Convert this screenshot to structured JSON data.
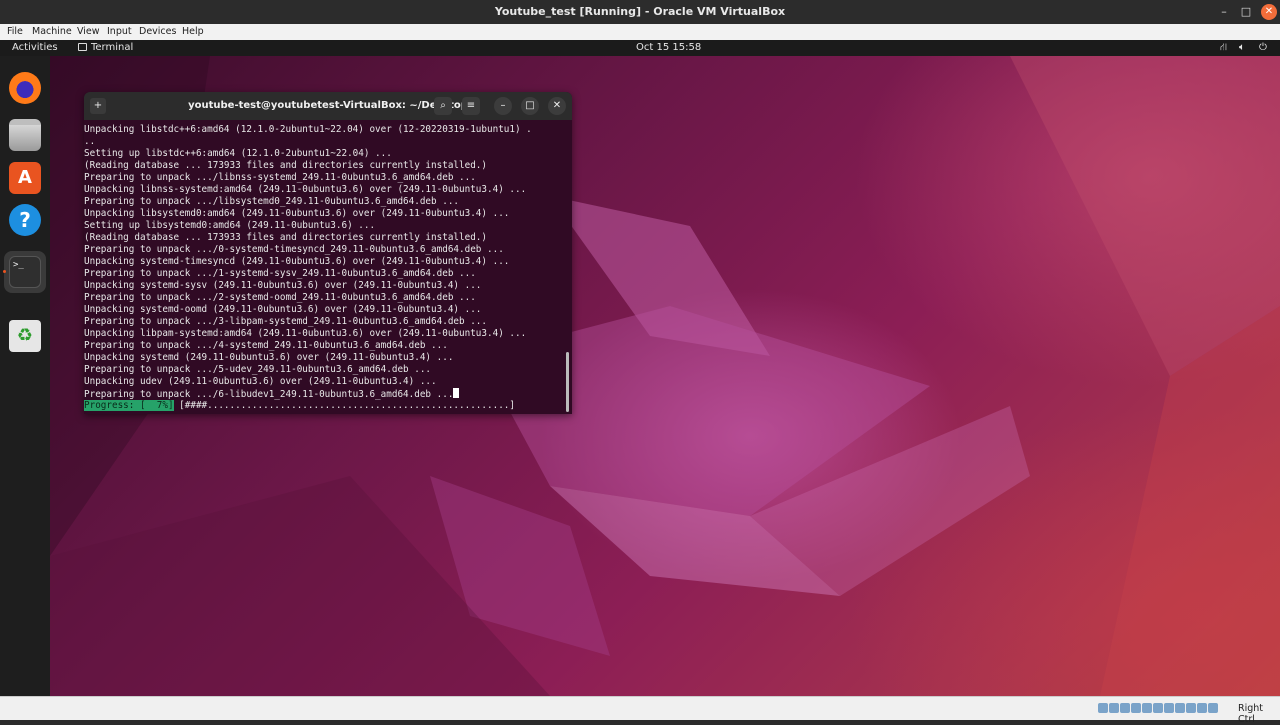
{
  "vbox": {
    "title": "Youtube_test [Running] - Oracle VM VirtualBox",
    "menu": [
      "File",
      "Machine",
      "View",
      "Input",
      "Devices",
      "Help"
    ],
    "host_key": "Right Ctrl"
  },
  "topbar": {
    "activities": "Activities",
    "app": "Terminal",
    "clock": "Oct 15  15:58"
  },
  "terminal": {
    "title": "youtube-test@youtubetest-VirtualBox: ~/Desktop",
    "lines": [
      "Unpacking libstdc++6:amd64 (12.1.0-2ubuntu1~22.04) over (12-20220319-1ubuntu1) .",
      "..",
      "Setting up libstdc++6:amd64 (12.1.0-2ubuntu1~22.04) ...",
      "(Reading database ... 173933 files and directories currently installed.)",
      "Preparing to unpack .../libnss-systemd_249.11-0ubuntu3.6_amd64.deb ...",
      "Unpacking libnss-systemd:amd64 (249.11-0ubuntu3.6) over (249.11-0ubuntu3.4) ...",
      "Preparing to unpack .../libsystemd0_249.11-0ubuntu3.6_amd64.deb ...",
      "Unpacking libsystemd0:amd64 (249.11-0ubuntu3.6) over (249.11-0ubuntu3.4) ...",
      "Setting up libsystemd0:amd64 (249.11-0ubuntu3.6) ...",
      "(Reading database ... 173933 files and directories currently installed.)",
      "Preparing to unpack .../0-systemd-timesyncd_249.11-0ubuntu3.6_amd64.deb ...",
      "Unpacking systemd-timesyncd (249.11-0ubuntu3.6) over (249.11-0ubuntu3.4) ...",
      "Preparing to unpack .../1-systemd-sysv_249.11-0ubuntu3.6_amd64.deb ...",
      "Unpacking systemd-sysv (249.11-0ubuntu3.6) over (249.11-0ubuntu3.4) ...",
      "Preparing to unpack .../2-systemd-oomd_249.11-0ubuntu3.6_amd64.deb ...",
      "Unpacking systemd-oomd (249.11-0ubuntu3.6) over (249.11-0ubuntu3.4) ...",
      "Preparing to unpack .../3-libpam-systemd_249.11-0ubuntu3.6_amd64.deb ...",
      "Unpacking libpam-systemd:amd64 (249.11-0ubuntu3.6) over (249.11-0ubuntu3.4) ...",
      "Preparing to unpack .../4-systemd_249.11-0ubuntu3.6_amd64.deb ...",
      "Unpacking systemd (249.11-0ubuntu3.6) over (249.11-0ubuntu3.4) ...",
      "Preparing to unpack .../5-udev_249.11-0ubuntu3.6_amd64.deb ...",
      "Unpacking udev (249.11-0ubuntu3.6) over (249.11-0ubuntu3.4) ...",
      "Preparing to unpack .../6-libudev1_249.11-0ubuntu3.6_amd64.deb ..."
    ],
    "progress_label": "Progress: [  7%]",
    "progress_bar": " [####......................................................]",
    "progress_percent": 7
  },
  "dock": {
    "items": [
      "firefox-icon",
      "files-icon",
      "software-icon",
      "help-icon",
      "terminal-icon",
      "trash-icon"
    ]
  },
  "colors": {
    "terminal_bg": "#300a24",
    "accent": "#e95420",
    "progress_green": "#26a269"
  }
}
